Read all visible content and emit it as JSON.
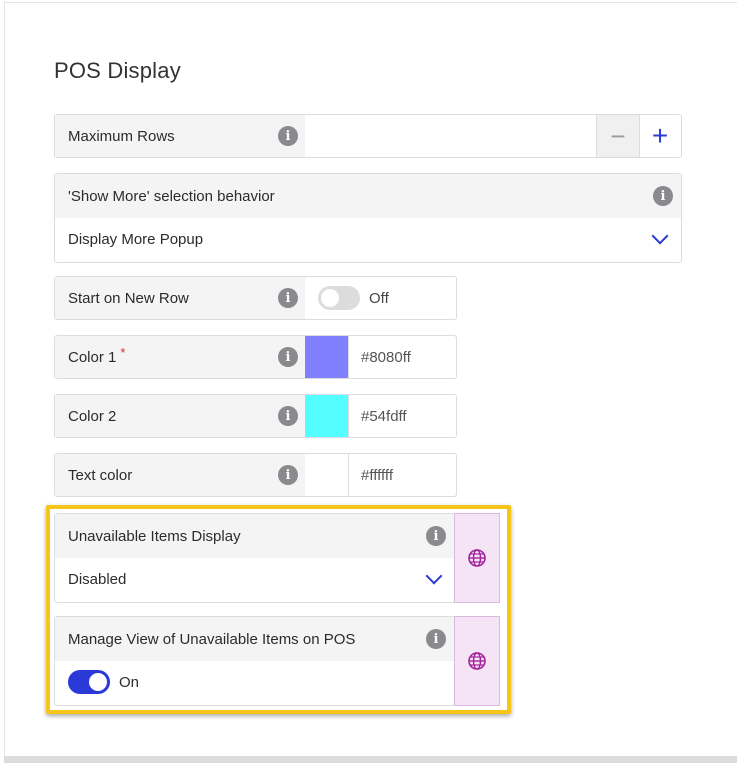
{
  "page": {
    "title": "POS Display"
  },
  "maximum_rows": {
    "label": "Maximum Rows",
    "value": ""
  },
  "show_more": {
    "label": "'Show More' selection behavior",
    "value": "Display More Popup"
  },
  "start_new_row": {
    "label": "Start on New Row",
    "state": "Off"
  },
  "color1": {
    "label": "Color 1",
    "required_mark": "*",
    "value": "#8080ff",
    "swatch": "#8080ff"
  },
  "color2": {
    "label": "Color 2",
    "value": "#54fdff",
    "swatch": "#54fdff"
  },
  "text_color": {
    "label": "Text color",
    "value": "#ffffff",
    "swatch": "#ffffff"
  },
  "unavailable_display": {
    "label": "Unavailable Items Display",
    "value": "Disabled"
  },
  "manage_view": {
    "label": "Manage View of Unavailable Items on POS",
    "state": "On"
  },
  "icons": {
    "info": "i",
    "minus": "−",
    "plus": "+"
  },
  "colors": {
    "accent": "#2b3ad6",
    "highlight": "#f5c518",
    "globe": "#a3229c"
  }
}
